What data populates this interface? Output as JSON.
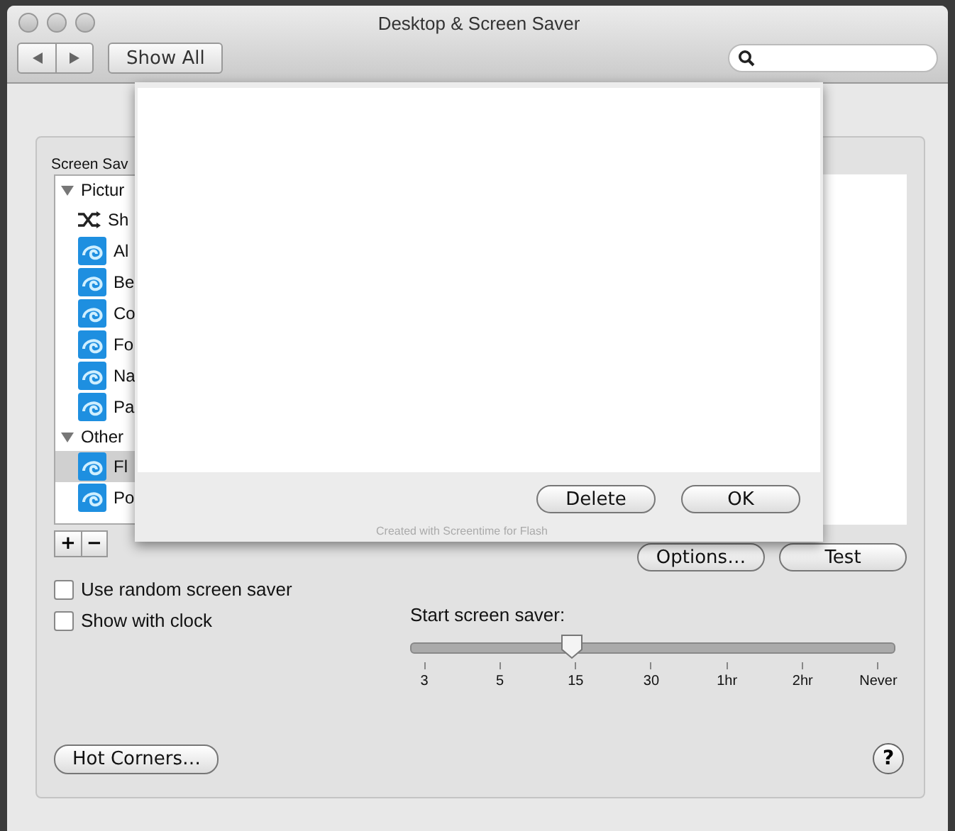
{
  "window": {
    "title": "Desktop & Screen Saver"
  },
  "toolbar": {
    "show_all": "Show All"
  },
  "screen_saver_label": "Screen Sav",
  "saver_list": [
    {
      "kind": "header",
      "label": "Pictur",
      "expanded": true,
      "selected": false
    },
    {
      "kind": "shuffle",
      "label": "Sh",
      "selected": false
    },
    {
      "kind": "saver",
      "label": "Al",
      "selected": false
    },
    {
      "kind": "saver",
      "label": "Be",
      "selected": false
    },
    {
      "kind": "saver",
      "label": "Co",
      "selected": false
    },
    {
      "kind": "saver",
      "label": "Fo",
      "selected": false
    },
    {
      "kind": "saver",
      "label": "Na",
      "selected": false
    },
    {
      "kind": "saver",
      "label": "Pa",
      "selected": false
    },
    {
      "kind": "header",
      "label": "Other",
      "expanded": true,
      "selected": false
    },
    {
      "kind": "saver",
      "label": "Fl",
      "selected": true
    },
    {
      "kind": "saver",
      "label": "Po",
      "selected": false
    }
  ],
  "list_buttons": [
    "+",
    "−"
  ],
  "preview_buttons": [
    "Options…",
    "Test"
  ],
  "checkboxes": [
    {
      "label": "Use random screen saver",
      "checked": false
    },
    {
      "label": "Show with clock",
      "checked": false
    }
  ],
  "start_slider": {
    "label": "Start screen saver:",
    "level": 0.333,
    "ticks": [
      "3",
      "5",
      "15",
      "30",
      "1hr",
      "2hr",
      "Never"
    ]
  },
  "hot_corners": "Hot Corners…",
  "help": "?",
  "sheet": {
    "buttons": [
      "Delete",
      "OK"
    ],
    "credit": "Created with Screentime for Flash"
  }
}
